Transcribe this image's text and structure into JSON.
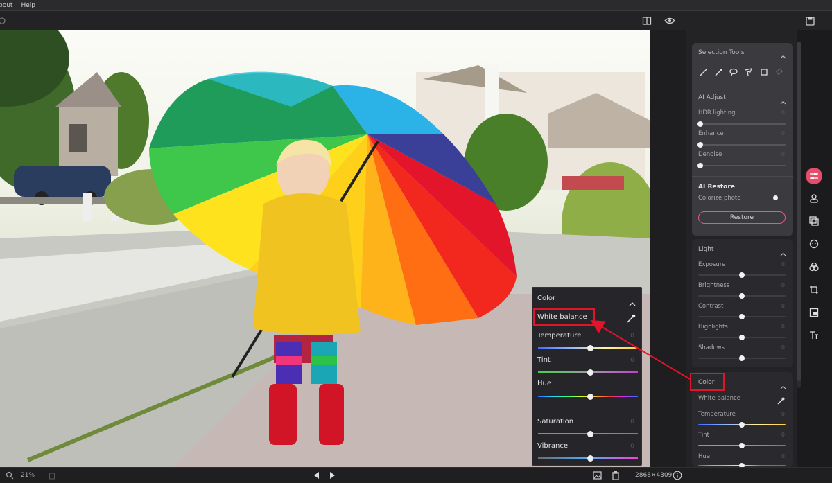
{
  "menu": {
    "items": [
      "bout",
      "Help"
    ]
  },
  "selection_tools": {
    "title": "Selection Tools"
  },
  "ai_adjust": {
    "title": "AI Adjust",
    "sliders": [
      {
        "label": "HDR lighting",
        "value": "0"
      },
      {
        "label": "Enhance",
        "value": "0"
      },
      {
        "label": "Denoise",
        "value": "0"
      }
    ]
  },
  "ai_restore": {
    "title": "AI Restore",
    "toggle_label": "Colorize photo",
    "button": "Restore"
  },
  "light": {
    "title": "Light",
    "sliders": [
      {
        "label": "Exposure",
        "value": "0"
      },
      {
        "label": "Brightness",
        "value": "0"
      },
      {
        "label": "Contrast",
        "value": "0"
      },
      {
        "label": "Highlights",
        "value": "0"
      },
      {
        "label": "Shadows",
        "value": "0"
      }
    ]
  },
  "color_panel": {
    "title": "Color",
    "white_balance": "White balance",
    "sliders": [
      {
        "label": "Temperature",
        "value": "0"
      },
      {
        "label": "Tint",
        "value": "0"
      },
      {
        "label": "Hue",
        "value": "0"
      }
    ]
  },
  "color_popup": {
    "title": "Color",
    "white_balance": "White balance",
    "sliders": [
      {
        "label": "Temperature",
        "value": "0"
      },
      {
        "label": "Tint",
        "value": "0"
      },
      {
        "label": "Hue",
        "value": ""
      },
      {
        "label": "Saturation",
        "value": "0"
      },
      {
        "label": "Vibrance",
        "value": "0"
      }
    ]
  },
  "status": {
    "zoom": "21%",
    "dimensions": "2868×4309"
  },
  "colors": {
    "accent": "#e44d6c",
    "highlight": "#e2142a"
  }
}
